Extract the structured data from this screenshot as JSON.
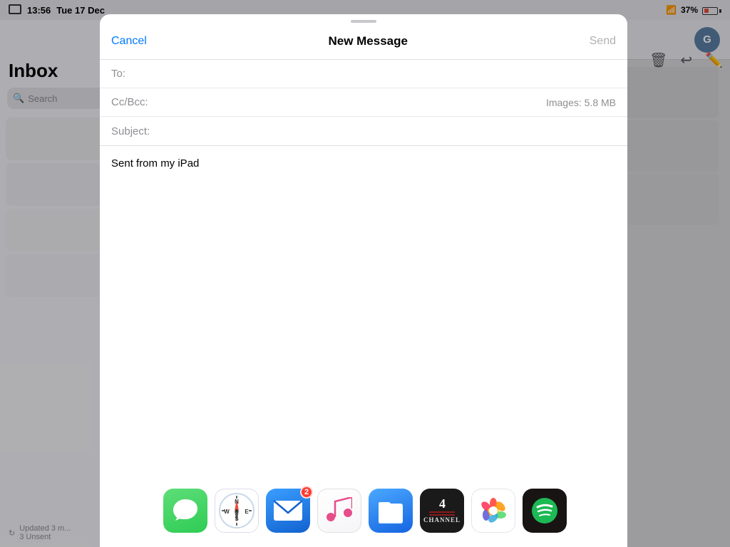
{
  "statusBar": {
    "time": "13:56",
    "date": "Tue 17 Dec",
    "battery": "37%",
    "wifi": "WiFi"
  },
  "sidebar": {
    "title": "Inbox",
    "search": {
      "placeholder": "Search"
    },
    "bottom": {
      "updated": "Updated 3 m...",
      "unsent": "3 Unsent"
    }
  },
  "modal": {
    "drag_handle": "",
    "cancel_label": "Cancel",
    "title": "New Message",
    "send_label": "Send",
    "fields": {
      "to_label": "To:",
      "to_value": "",
      "ccbcc_label": "Cc/Bcc:",
      "attachment_label": "Images: 5.8 MB",
      "subject_label": "Subject:",
      "subject_value": ""
    },
    "body": "Sent from my iPad"
  },
  "dock": {
    "apps": [
      {
        "name": "Messages",
        "icon": "messages",
        "badge": null
      },
      {
        "name": "Safari",
        "icon": "safari",
        "badge": null
      },
      {
        "name": "Mail",
        "icon": "mail",
        "badge": "2"
      },
      {
        "name": "Music",
        "icon": "music",
        "badge": null
      },
      {
        "name": "Files",
        "icon": "files",
        "badge": null
      },
      {
        "name": "Channel 4",
        "icon": "ch4",
        "badge": null
      },
      {
        "name": "Photos",
        "icon": "photos",
        "badge": null
      },
      {
        "name": "Spotify",
        "icon": "spotify",
        "badge": null
      }
    ]
  },
  "toolbar": {
    "icons": [
      "trash",
      "reply",
      "compose"
    ]
  }
}
